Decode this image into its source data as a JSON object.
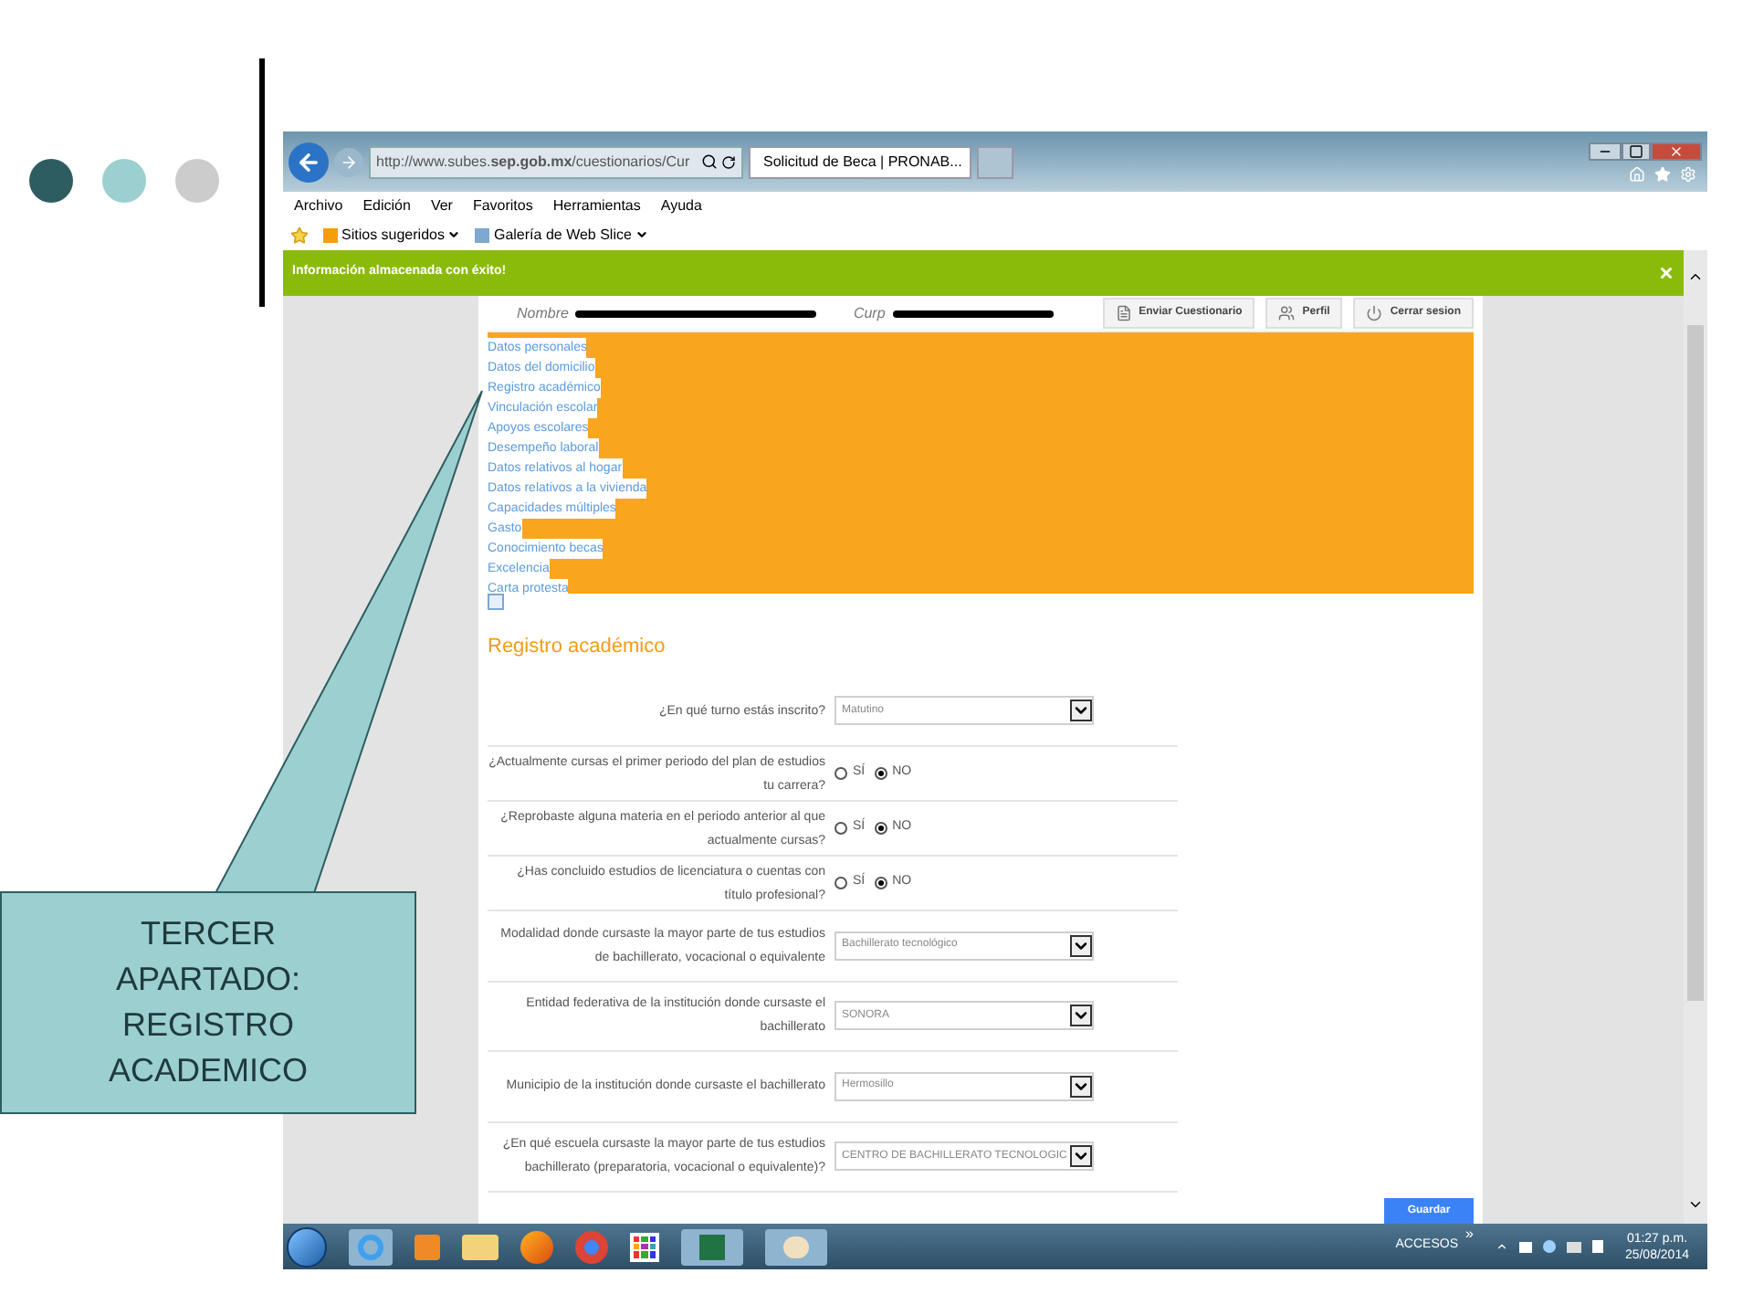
{
  "slide": {
    "callout": "TERCER APARTADO: REGISTRO ACADEMICO"
  },
  "browser": {
    "address": "http://www.subes.**sep.gob.mx**/cuestionarios/Cur",
    "tab": "Solicitud de Beca | PRONAB...",
    "menu": [
      "Archivo",
      "Edición",
      "Ver",
      "Favoritos",
      "Herramientas",
      "Ayuda"
    ],
    "favorites": [
      "Sitios sugeridos",
      "Galería de Web Slice"
    ]
  },
  "notification": {
    "message": "Información almacenada con éxito!"
  },
  "header": {
    "name_label": "Nombre",
    "curp_label": "Curp",
    "buttons": [
      "Enviar Cuestionario",
      "Perfil",
      "Cerrar sesion"
    ]
  },
  "nav": {
    "links": [
      "Datos personales",
      "Datos del domicilio",
      "Registro académico",
      "Vinculación escolar",
      "Apoyos escolares",
      "Desempeño laboral",
      "Datos relativos al hogar",
      "Datos relativos a la vivienda",
      "Capacidades múltiples",
      "Gasto",
      "Conocimiento becas",
      "Excelencia",
      "Carta protesta"
    ]
  },
  "form": {
    "title": "Registro académico",
    "fields": [
      {
        "kind": "select",
        "label": "¿En qué turno estás inscrito?",
        "value": "Matutino"
      },
      {
        "kind": "radio",
        "label": "¿Actualmente cursas el primer periodo del plan de estudios tu carrera?",
        "options": [
          {
            "label": "SÍ",
            "selected": false
          },
          {
            "label": "NO",
            "selected": true
          }
        ]
      },
      {
        "kind": "radio",
        "label": "¿Reprobaste alguna materia en el periodo anterior al que actualmente cursas?",
        "options": [
          {
            "label": "SÍ",
            "selected": false
          },
          {
            "label": "NO",
            "selected": true
          }
        ]
      },
      {
        "kind": "radio",
        "label": "¿Has concluido estudios de licenciatura o cuentas con título profesional?",
        "options": [
          {
            "label": "SÍ",
            "selected": false
          },
          {
            "label": "NO",
            "selected": true
          }
        ]
      },
      {
        "kind": "select",
        "label": "Modalidad donde cursaste la mayor parte de tus estudios de bachillerato, vocacional o equivalente",
        "value": "Bachillerato tecnológico"
      },
      {
        "kind": "select",
        "label": "Entidad federativa de la institución donde cursaste el bachillerato",
        "value": "SONORA"
      },
      {
        "kind": "select",
        "label": "Municipio de la institución donde cursaste el bachillerato",
        "value": "Hermosillo"
      },
      {
        "kind": "select",
        "label": "¿En qué escuela cursaste la mayor parte de tus estudios bachillerato (preparatoria, vocacional o equivalente)?",
        "value": "CENTRO DE BACHILLERATO TECNOLOGIC"
      }
    ],
    "submit": "Guardar"
  },
  "taskbar": {
    "accesos": "ACCESOS",
    "chevron": "»",
    "time": "01:27 p.m.",
    "date": "25/08/2014"
  }
}
